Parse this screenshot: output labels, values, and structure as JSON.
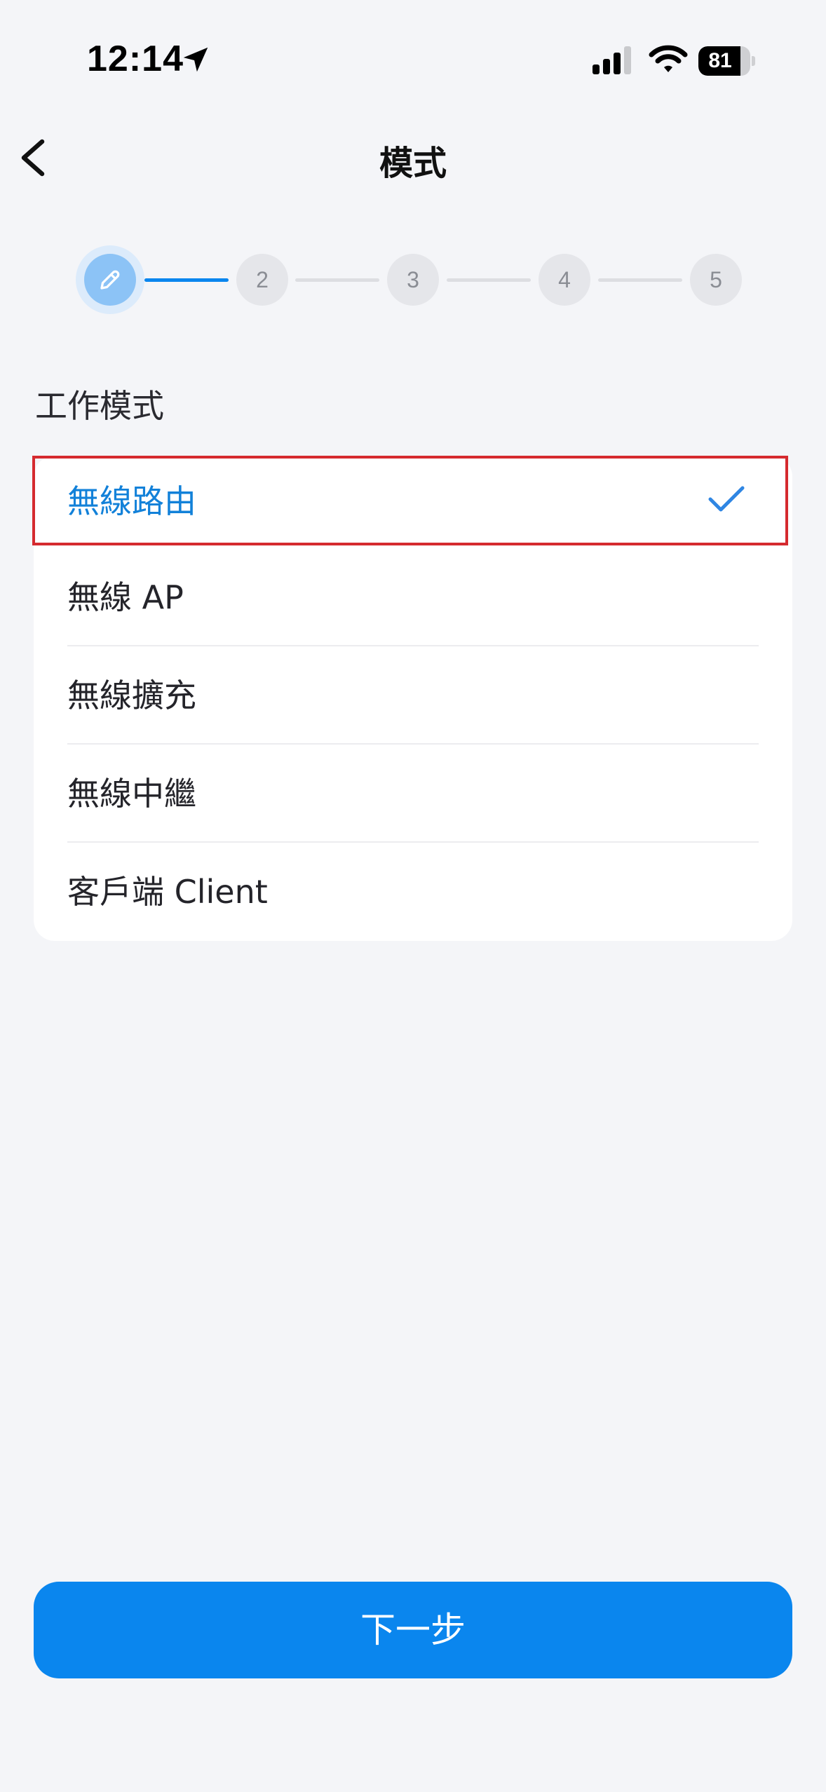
{
  "status_bar": {
    "time": "12:14",
    "battery": "81",
    "battery_level": 0.81,
    "icons": [
      "location-arrow-icon",
      "cellular-signal-icon",
      "wifi-icon",
      "battery-icon"
    ]
  },
  "header": {
    "title": "模式",
    "back_icon": "chevron-left-icon"
  },
  "stepper": {
    "current_step": 1,
    "current_icon": "pencil-icon",
    "steps": [
      "2",
      "3",
      "4",
      "5"
    ],
    "active_color": "#0a86ee",
    "inactive_color": "#e5e6ea"
  },
  "section": {
    "label": "工作模式"
  },
  "options": [
    {
      "label": "無線路由",
      "selected": true
    },
    {
      "label": "無線 AP",
      "selected": false
    },
    {
      "label": "無線擴充",
      "selected": false
    },
    {
      "label": "無線中繼",
      "selected": false
    },
    {
      "label": "客戶端 Client",
      "selected": false
    }
  ],
  "footer": {
    "next_label": "下一步"
  },
  "colors": {
    "accent": "#0a86ee",
    "selected_text": "#1281d9",
    "highlight_border": "#d52a2f"
  }
}
